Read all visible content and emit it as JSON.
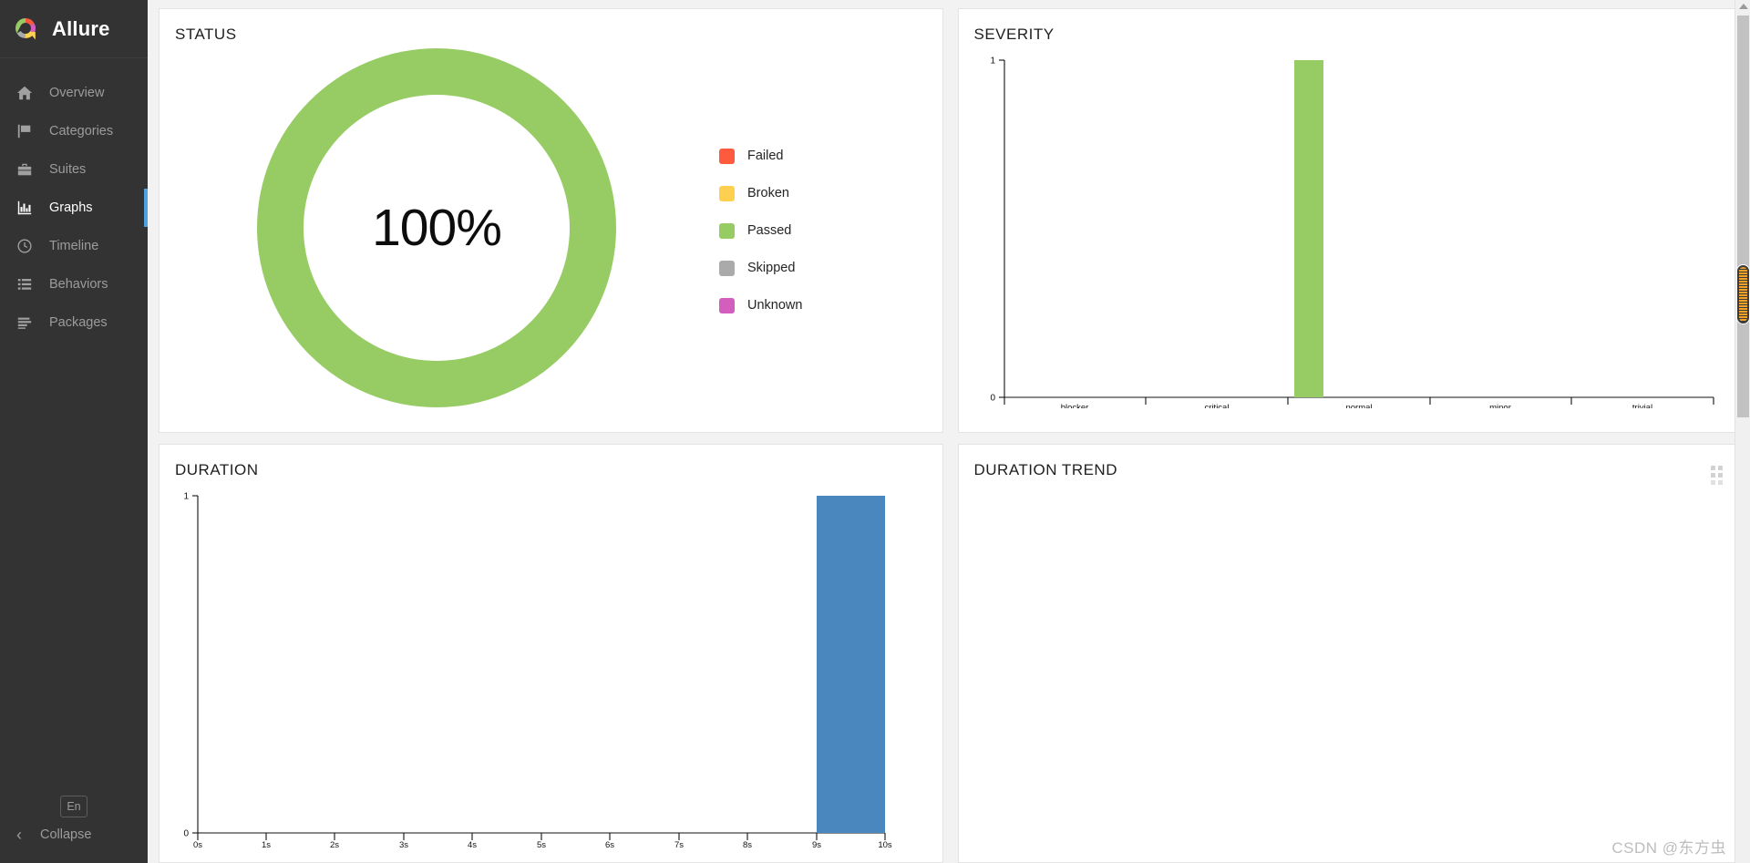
{
  "brand": {
    "name": "Allure",
    "logo_icon": "allure-donut-logo"
  },
  "sidebar": {
    "items": [
      {
        "label": "Overview",
        "icon": "home-icon",
        "active": false
      },
      {
        "label": "Categories",
        "icon": "flag-icon",
        "active": false
      },
      {
        "label": "Suites",
        "icon": "briefcase-icon",
        "active": false
      },
      {
        "label": "Graphs",
        "icon": "bar-chart-icon",
        "active": true
      },
      {
        "label": "Timeline",
        "icon": "clock-icon",
        "active": false
      },
      {
        "label": "Behaviors",
        "icon": "list-icon",
        "active": false
      },
      {
        "label": "Packages",
        "icon": "stack-icon",
        "active": false
      }
    ],
    "language_button": "En",
    "collapse_label": "Collapse",
    "collapse_icon": "chevron-left-icon",
    "active_accent_color": "#4aa3e0"
  },
  "cards": {
    "status": {
      "title": "STATUS"
    },
    "severity": {
      "title": "SEVERITY"
    },
    "duration": {
      "title": "DURATION"
    },
    "duration_trend": {
      "title": "DURATION TREND",
      "drag_handle_icon": "drag-dots-icon"
    }
  },
  "status_legend": [
    {
      "label": "Failed",
      "color": "#fd5a3e"
    },
    {
      "label": "Broken",
      "color": "#ffd050"
    },
    {
      "label": "Passed",
      "color": "#97cc64"
    },
    {
      "label": "Skipped",
      "color": "#aaaaaa"
    },
    {
      "label": "Unknown",
      "color": "#d35ebe"
    }
  ],
  "status_center_value": "100%",
  "watermark": "CSDN @东方虫",
  "chart_data": [
    {
      "type": "pie",
      "title": "STATUS",
      "labels": [
        "Failed",
        "Broken",
        "Passed",
        "Skipped",
        "Unknown"
      ],
      "values": [
        0,
        0,
        1,
        0,
        0
      ],
      "colors": [
        "#fd5a3e",
        "#ffd050",
        "#97cc64",
        "#aaaaaa",
        "#d35ebe"
      ],
      "center_label": "100%",
      "legend": "right",
      "donut": true
    },
    {
      "type": "bar",
      "title": "SEVERITY",
      "categories": [
        "blocker",
        "critical",
        "normal",
        "minor",
        "trivial"
      ],
      "values": [
        0,
        0,
        1,
        0,
        0
      ],
      "bar_color": "#97cc64",
      "xlabel": "",
      "ylabel": "",
      "ylim": [
        0,
        1
      ],
      "yticks": [
        "0",
        "1"
      ],
      "grid": false
    },
    {
      "type": "bar",
      "title": "DURATION",
      "categories": [
        "0s",
        "1s",
        "2s",
        "3s",
        "4s",
        "5s",
        "6s",
        "7s",
        "8s",
        "9s",
        "10s"
      ],
      "values": [
        0,
        0,
        0,
        0,
        0,
        0,
        0,
        0,
        0,
        1
      ],
      "bar_color": "#4a87be",
      "xlabel": "",
      "ylabel": "",
      "ylim": [
        0,
        1
      ],
      "yticks": [
        "0",
        "1"
      ],
      "xlim": [
        0,
        10
      ],
      "grid": false
    },
    {
      "type": "line",
      "title": "DURATION TREND",
      "x": [],
      "series": [],
      "empty": true
    }
  ]
}
